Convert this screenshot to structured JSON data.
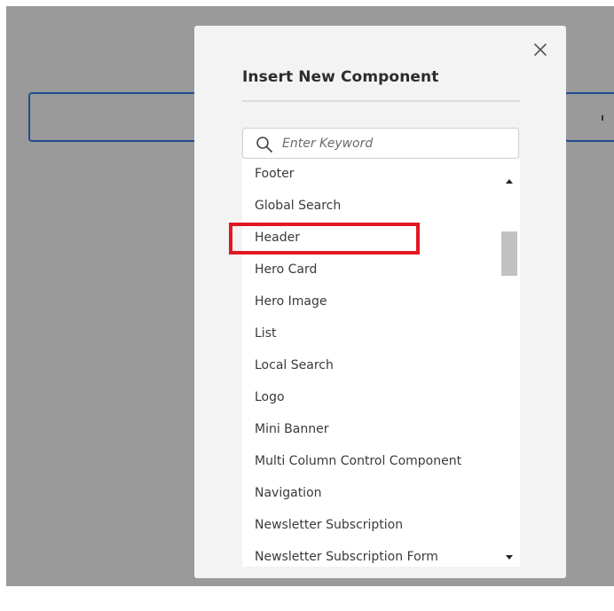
{
  "dialog": {
    "title": "Insert New Component",
    "close_icon": "close-icon"
  },
  "search": {
    "placeholder": "Enter Keyword",
    "value": "",
    "icon": "search-icon"
  },
  "components": {
    "items": [
      "Footer",
      "Global Search",
      "Header",
      "Hero Card",
      "Hero Image",
      "List",
      "Local Search",
      "Logo",
      "Mini Banner",
      "Multi Column Control Component",
      "Navigation",
      "Newsletter Subscription",
      "Newsletter Subscription Form"
    ],
    "highlighted": "Header"
  },
  "colors": {
    "overlay": "#9a9a9a",
    "dialog_bg": "#f3f3f3",
    "highlight": "#e01822",
    "field_border": "#1f4f8f"
  }
}
